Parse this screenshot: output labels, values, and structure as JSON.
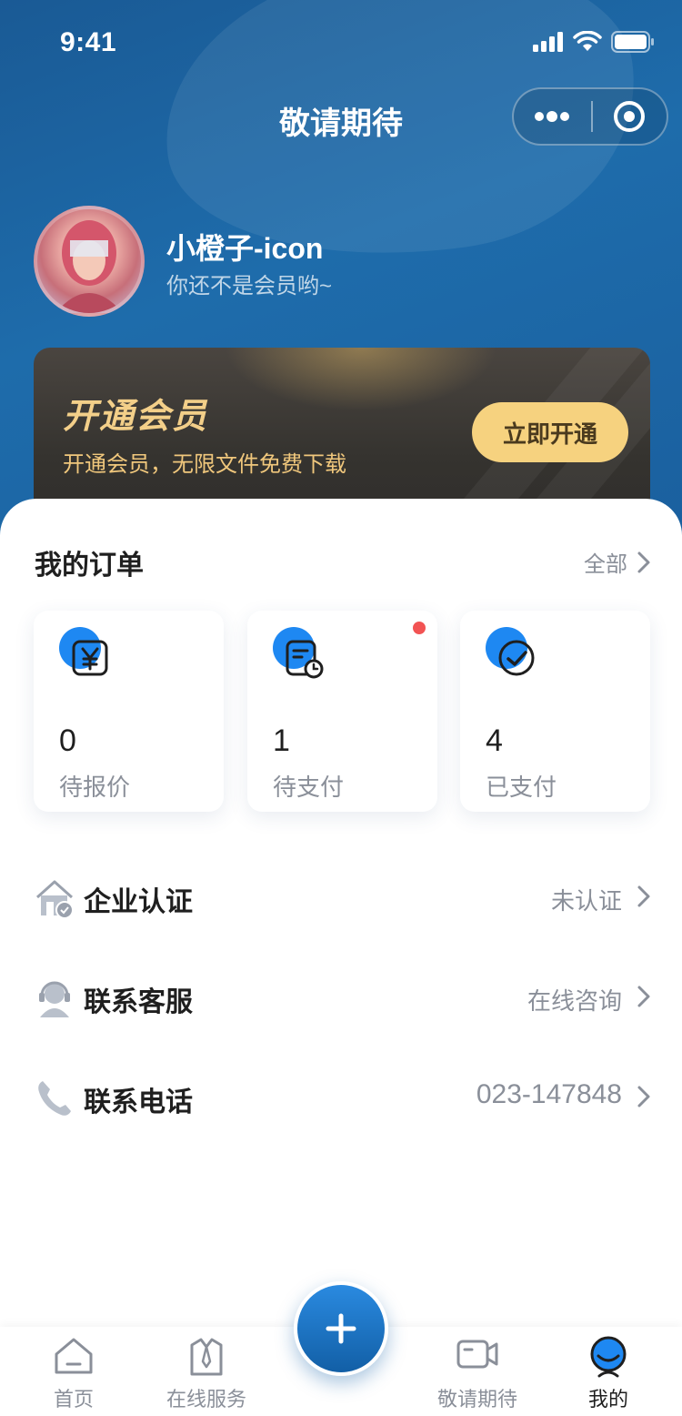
{
  "status_bar": {
    "time": "9:41"
  },
  "navbar": {
    "title": "敬请期待"
  },
  "user": {
    "name": "小橙子-icon",
    "subtitle": "你还不是会员哟~"
  },
  "vip": {
    "title": "开通会员",
    "subtitle": "开通会员，无限文件免费下载",
    "button_label": "立即开通"
  },
  "orders": {
    "title": "我的订单",
    "more_label": "全部",
    "items": [
      {
        "count": "0",
        "label": "待报价",
        "icon": "yen-document-icon",
        "has_badge": false
      },
      {
        "count": "1",
        "label": "待支付",
        "icon": "bill-clock-icon",
        "has_badge": true
      },
      {
        "count": "4",
        "label": "已支付",
        "icon": "check-circle-icon",
        "has_badge": false
      }
    ]
  },
  "menu": [
    {
      "label": "企业认证",
      "value": "未认证",
      "icon": "enterprise-house-icon"
    },
    {
      "label": "联系客服",
      "value": "在线咨询",
      "icon": "customer-service-icon"
    },
    {
      "label": "联系电话",
      "value": "023-147848",
      "icon": "phone-icon"
    }
  ],
  "tabbar": {
    "items": [
      {
        "label": "首页",
        "icon": "home-icon",
        "active": false
      },
      {
        "label": "在线服务",
        "icon": "service-suit-icon",
        "active": false
      },
      {
        "label": "敬请期待",
        "icon": "video-camera-icon",
        "active": false
      },
      {
        "label": "我的",
        "icon": "profile-face-icon",
        "active": true
      }
    ]
  },
  "colors": {
    "primary": "#1e6cab",
    "accent_blue": "#1e88f2",
    "vip_gold": "#f6d27f",
    "badge_red": "#f25353"
  }
}
